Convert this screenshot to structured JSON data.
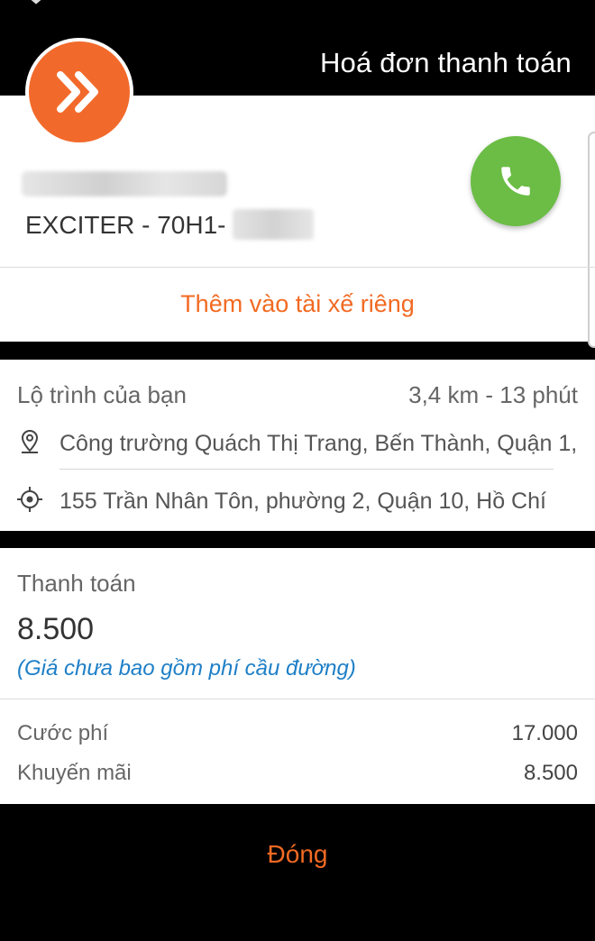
{
  "header": {
    "title": "Hoá đơn thanh toán"
  },
  "driver": {
    "vehicle_label": "EXCITER  -  70H1-",
    "add_private_driver_label": "Thêm vào tài xế riêng"
  },
  "route": {
    "title": "Lộ trình của bạn",
    "meta": "3,4 km - 13 phút",
    "pickup": "Công trường Quách Thị Trang, Bến Thành, Quận 1,",
    "dropoff": "155 Trần Nhân Tôn, phường 2, Quận 10, Hồ Chí"
  },
  "payment": {
    "title": "Thanh toán",
    "amount": "8.500",
    "note": "(Giá chưa bao gồm phí cầu đường)",
    "fare_label": "Cước phí",
    "fare_value": "17.000",
    "promo_label": "Khuyến mãi",
    "promo_value": "8.500"
  },
  "footer": {
    "close_label": "Đóng"
  },
  "icons": {
    "logo": "double-chevron-right-icon",
    "call": "phone-icon",
    "pickup": "map-pin-icon",
    "dropoff": "crosshair-target-icon"
  },
  "colors": {
    "brand_orange": "#f26a2b",
    "call_green": "#6bbd45",
    "note_blue": "#1e7fc7"
  }
}
